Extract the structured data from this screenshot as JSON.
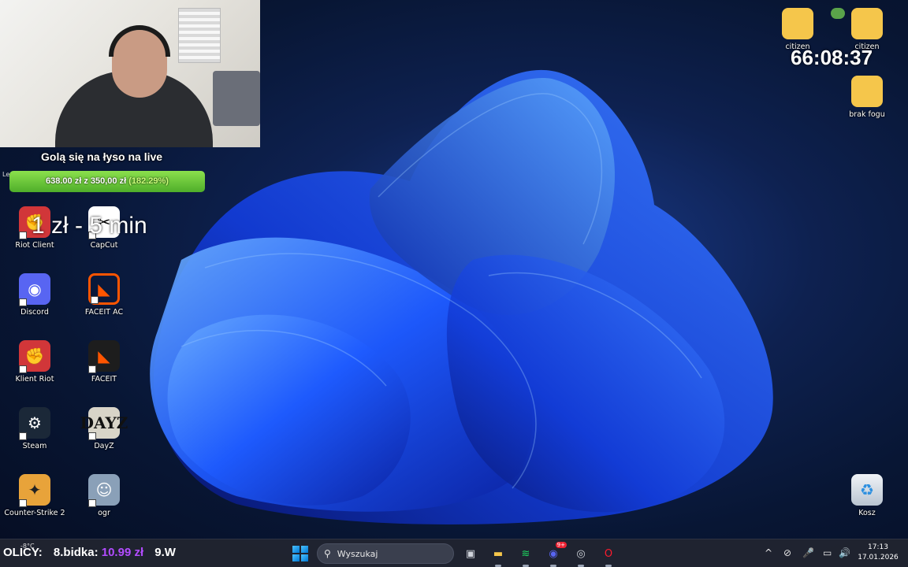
{
  "overlay": {
    "goal_title": "Golą się na łyso na live",
    "goal_raised": "638.00 zł",
    "goal_of": "z",
    "goal_target": "350,00 zł",
    "goal_percent": "(182.29%)",
    "goal_progress": 1.0,
    "timer_text": "1 zł - 5 min",
    "side_label": "Le",
    "countdown": "66:08:37"
  },
  "desktop": {
    "left_icons": [
      {
        "label": "Riot Client",
        "icon": "riot-fist-icon",
        "glyph": "✊"
      },
      {
        "label": "CapCut",
        "icon": "capcut-icon",
        "glyph": "✂"
      },
      {
        "label": "Discord",
        "icon": "discord-icon",
        "glyph": "◉"
      },
      {
        "label": "FACEIT AC",
        "icon": "faceit-ac-shield-icon",
        "glyph": "◣"
      },
      {
        "label": "Klient Riot",
        "icon": "riot-fist-icon",
        "glyph": "✊"
      },
      {
        "label": "FACEIT",
        "icon": "faceit-icon",
        "glyph": "◣"
      },
      {
        "label": "Steam",
        "icon": "steam-icon",
        "glyph": "⚙"
      },
      {
        "label": "DayZ",
        "icon": "dayz-icon",
        "glyph": "DAYZ"
      },
      {
        "label": "Counter-Strike 2",
        "icon": "cs2-icon",
        "glyph": "✦"
      },
      {
        "label": "ogr",
        "icon": "ogr-photo-icon",
        "glyph": "☺"
      }
    ],
    "right_icons": [
      {
        "label": "citizen",
        "icon": "folder-icon"
      },
      {
        "label": "citizen",
        "icon": "folder-icon"
      },
      {
        "label": "brak fogu",
        "icon": "folder-icon"
      },
      {
        "label": "Kosz",
        "icon": "recycle-bin-icon",
        "glyph": "♻"
      }
    ]
  },
  "taskbar": {
    "ticker_prefix": "OLICY:",
    "ticker_bid_label": "8.bidka:",
    "ticker_bid_value": "10.99 zł",
    "ticker_next": "9.W",
    "weather_temp": "-8°C",
    "search_placeholder": "Wyszukaj",
    "apps": [
      {
        "name": "task-view",
        "glyph": "▣",
        "color": "#d0d4dc"
      },
      {
        "name": "file-explorer",
        "glyph": "▬",
        "color": "#f5c64b"
      },
      {
        "name": "spotify",
        "glyph": "≋",
        "color": "#1ed760"
      },
      {
        "name": "discord",
        "glyph": "◉",
        "color": "#5865f2",
        "badge": "9+"
      },
      {
        "name": "obs",
        "glyph": "◎",
        "color": "#cfd3da"
      },
      {
        "name": "opera",
        "glyph": "O",
        "color": "#ff1b2d"
      }
    ],
    "tray": [
      "^",
      "⊘",
      "🎤",
      "▭",
      "🔊"
    ],
    "time": "17:13",
    "date": "17.01.2026",
    "accent": "#0078d4"
  }
}
